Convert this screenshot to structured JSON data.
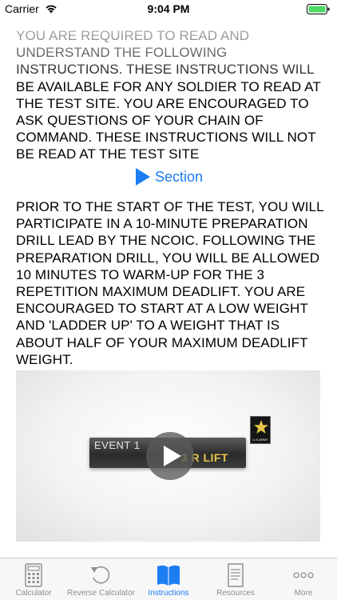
{
  "status_bar": {
    "carrier": "Carrier",
    "time": "9:04 PM",
    "wifi_icon": "wifi-icon",
    "battery_icon": "battery-icon"
  },
  "content": {
    "paragraph_1": "YOU ARE REQUIRED TO READ AND UNDERSTAND THE FOLLOWING INSTRUCTIONS. THESE INSTRUCTIONS WILL BE AVAILABLE FOR ANY SOLDIER TO READ AT THE TEST SITE. YOU ARE ENCOURAGED TO ASK QUESTIONS OF YOUR CHAIN OF COMMAND. THESE INSTRUCTIONS WILL NOT BE READ AT THE TEST SITE",
    "section_link": {
      "label": "Section",
      "icon": "play-triangle-icon"
    },
    "paragraph_2": "PRIOR TO THE START OF THE TEST, YOU WILL PARTICIPATE IN A 10-MINUTE PREPARATION DRILL LEAD BY THE NCOIC. FOLLOWING THE PREPARATION DRILL, YOU WILL BE ALLOWED 10 MINUTES TO WARM-UP FOR THE 3 REPETITION MAXIMUM DEADLIFT. YOU ARE ENCOURAGED TO START AT A LOW WEIGHT AND 'LADDER UP' TO A WEIGHT THAT IS ABOUT HALF OF YOUR MAXIMUM DEADLIFT WEIGHT.",
    "video": {
      "event_label": "EVENT 1",
      "title_partial": "3 R        LIFT",
      "logo_text": "U.S.ARMY",
      "play_icon": "play-icon"
    }
  },
  "tab_bar": {
    "active_color": "#1d7df2",
    "inactive_color": "#8e8e93",
    "tabs": [
      {
        "label": "Calculator",
        "icon": "calculator-icon",
        "active": false
      },
      {
        "label": "Reverse Calculator",
        "icon": "reverse-arrow-icon",
        "active": false
      },
      {
        "label": "Instructions",
        "icon": "book-icon",
        "active": true
      },
      {
        "label": "Resources",
        "icon": "document-icon",
        "active": false
      },
      {
        "label": "More",
        "icon": "more-dots-icon",
        "active": false
      }
    ]
  }
}
